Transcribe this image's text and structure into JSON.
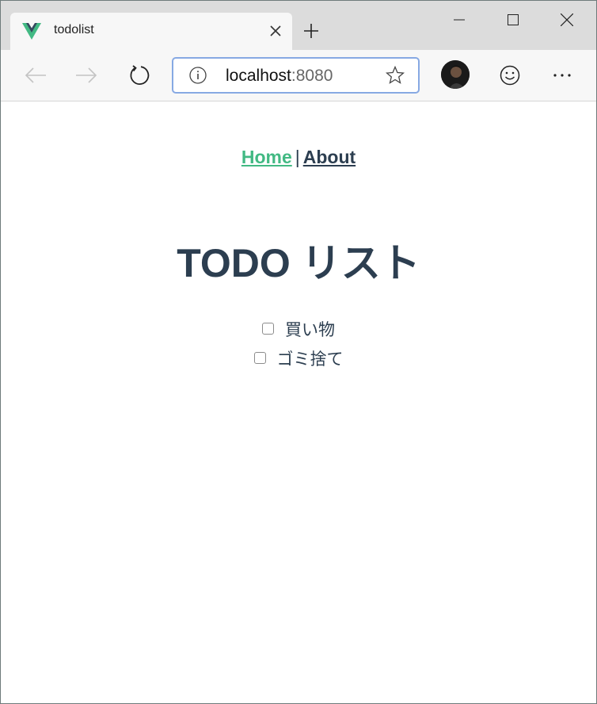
{
  "browser": {
    "tab_title": "todolist",
    "url_host": "localhost",
    "url_port": ":8080",
    "icons": {
      "favicon": "vue-logo-icon",
      "tab_close": "close-icon",
      "new_tab": "plus-icon",
      "minimize": "minimize-icon",
      "maximize": "maximize-icon",
      "window_close": "close-icon",
      "back": "arrow-left-icon",
      "forward": "arrow-right-icon",
      "refresh": "refresh-icon",
      "site_info": "info-icon",
      "favorite": "star-icon",
      "profile": "avatar",
      "feedback": "smiley-icon",
      "menu": "more-icon"
    }
  },
  "page": {
    "nav": {
      "home_label": "Home",
      "separator": "|",
      "about_label": "About"
    },
    "heading": "TODO リスト",
    "todos": [
      {
        "label": "買い物",
        "checked": false
      },
      {
        "label": "ゴミ捨て",
        "checked": false
      }
    ]
  },
  "colors": {
    "vue_green": "#42b983",
    "text_dark": "#2c3e50",
    "address_focus": "#87a9e3"
  }
}
